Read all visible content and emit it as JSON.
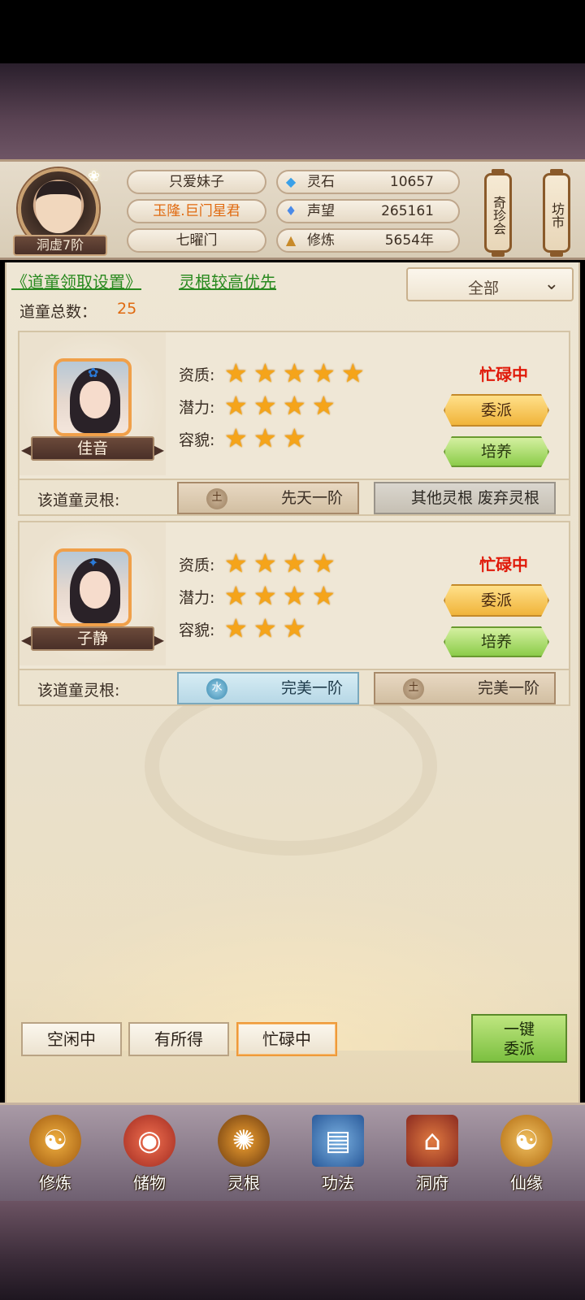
{
  "player": {
    "rank": "洞虚7阶",
    "name": "只爱妹子",
    "title": "玉隆.巨门星君",
    "sect": "七曜门"
  },
  "stats": [
    {
      "icon": "spirit-stone-icon",
      "label": "灵石",
      "value": "10657"
    },
    {
      "icon": "reputation-icon",
      "label": "声望",
      "value": "265161"
    },
    {
      "icon": "cultivation-icon",
      "label": "修炼",
      "value": "5654年"
    }
  ],
  "shops": {
    "treasure": "奇珍会",
    "market": "坊市"
  },
  "toolbar": {
    "settings_link": "《道童领取设置》",
    "priority_link": "灵根较高优先",
    "filter_value": "全部",
    "total_label": "道童总数：",
    "total_value": "25"
  },
  "labels": {
    "aptitude": "资质:",
    "potential": "潜力:",
    "appearance": "容貌:",
    "root_label": "该道童灵根:",
    "assign": "委派",
    "train": "培养"
  },
  "servants": [
    {
      "name": "佳音",
      "status": "忙碌中",
      "aptitude": 5,
      "potential": 4,
      "appearance": 3,
      "roots": [
        {
          "element": "土",
          "text": "先天一阶",
          "kind": "earth"
        },
        {
          "element": "",
          "text": "其他灵根 废弃灵根",
          "kind": "gray"
        }
      ]
    },
    {
      "name": "子静",
      "status": "忙碌中",
      "aptitude": 4,
      "potential": 4,
      "appearance": 3,
      "roots": [
        {
          "element": "水",
          "text": "完美一阶",
          "kind": "water"
        },
        {
          "element": "土",
          "text": "完美一阶",
          "kind": "earth"
        }
      ]
    }
  ],
  "filters": [
    {
      "label": "空闲中",
      "active": false
    },
    {
      "label": "有所得",
      "active": false
    },
    {
      "label": "忙碌中",
      "active": true
    }
  ],
  "quick_assign": [
    "一键",
    "委派"
  ],
  "nav": [
    {
      "label": "修炼",
      "icon": "meditating-monk-icon"
    },
    {
      "label": "储物",
      "icon": "storage-bag-icon"
    },
    {
      "label": "灵根",
      "icon": "spirit-root-icon"
    },
    {
      "label": "功法",
      "icon": "technique-book-icon"
    },
    {
      "label": "洞府",
      "icon": "cave-mansion-icon"
    },
    {
      "label": "仙缘",
      "icon": "immortal-fate-icon"
    }
  ],
  "colors": {
    "busy": "#e01a0a",
    "link": "#2a8a20",
    "count": "#e06a10",
    "star": "#f5a41a"
  }
}
